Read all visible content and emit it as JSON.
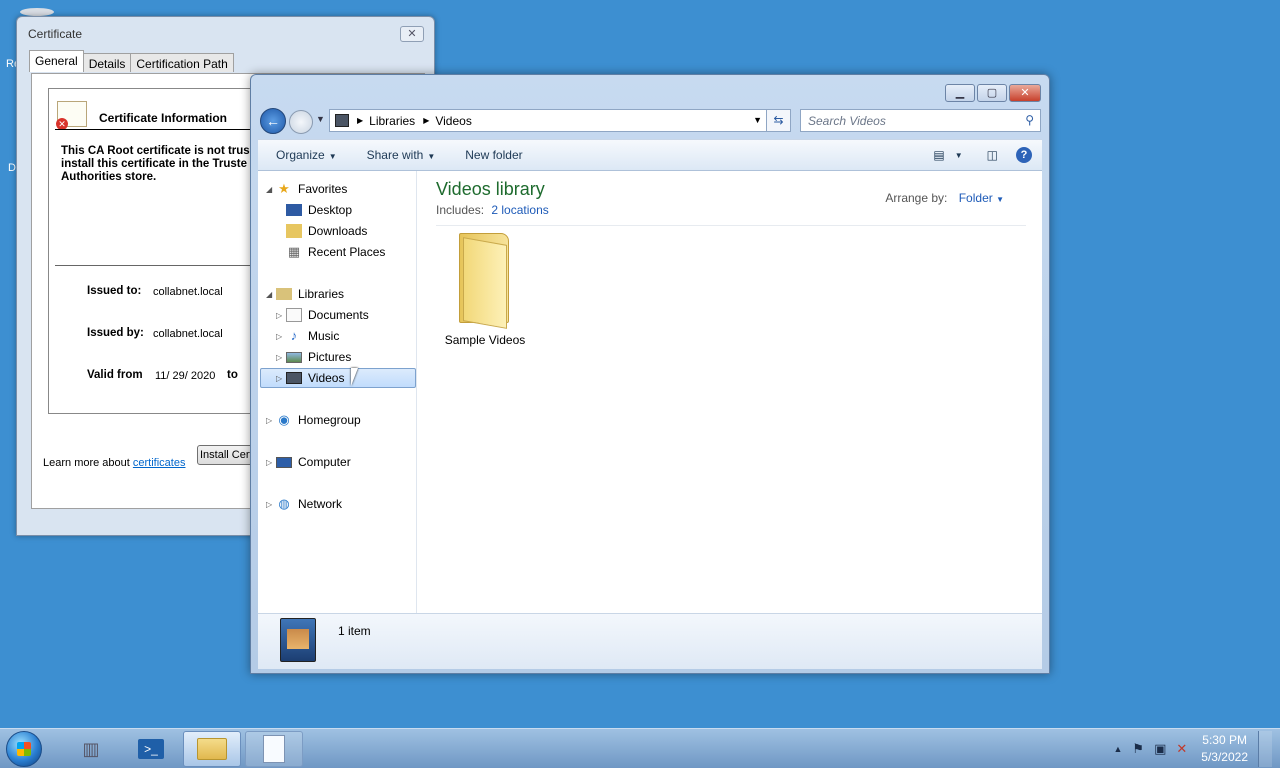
{
  "desktop": {
    "icon_label_1": "Re",
    "icon_label_2": "D"
  },
  "certificate": {
    "title": "Certificate",
    "close_glyph": "✕",
    "tabs": [
      "General",
      "Details",
      "Certification Path"
    ],
    "info_title": "Certificate Information",
    "warning": "This CA Root certificate is not trus install this certificate in the Truste Authorities store.",
    "issued_to_label": "Issued to:",
    "issued_to_value": "collabnet.local",
    "issued_by_label": "Issued by:",
    "issued_by_value": "collabnet.local",
    "valid_from_label": "Valid from",
    "valid_from_value": "11/ 29/ 2020",
    "valid_to_label": "to",
    "install_button": "Install Cert",
    "learn_more": "Learn more about",
    "learn_more_link": "certificates"
  },
  "explorer": {
    "breadcrumb": [
      "Libraries",
      "Videos"
    ],
    "search_placeholder": "Search Videos",
    "toolbar": {
      "organize": "Organize",
      "share_with": "Share with",
      "new_folder": "New folder"
    },
    "nav": {
      "favorites": "Favorites",
      "desktop": "Desktop",
      "downloads": "Downloads",
      "recent_places": "Recent Places",
      "libraries": "Libraries",
      "documents": "Documents",
      "music": "Music",
      "pictures": "Pictures",
      "videos": "Videos",
      "homegroup": "Homegroup",
      "computer": "Computer",
      "network": "Network"
    },
    "library_title": "Videos library",
    "includes_label": "Includes:",
    "includes_link": "2 locations",
    "arrange_label": "Arrange by:",
    "arrange_value": "Folder",
    "items": [
      {
        "name": "Sample Videos"
      }
    ],
    "status_count": "1 item"
  },
  "taskbar": {
    "time": "5:30 PM",
    "date": "5/3/2022"
  },
  "colors": {
    "desktop": "#3d8fd1",
    "library_title": "#1e6b2e",
    "link": "#1e5bb8"
  }
}
